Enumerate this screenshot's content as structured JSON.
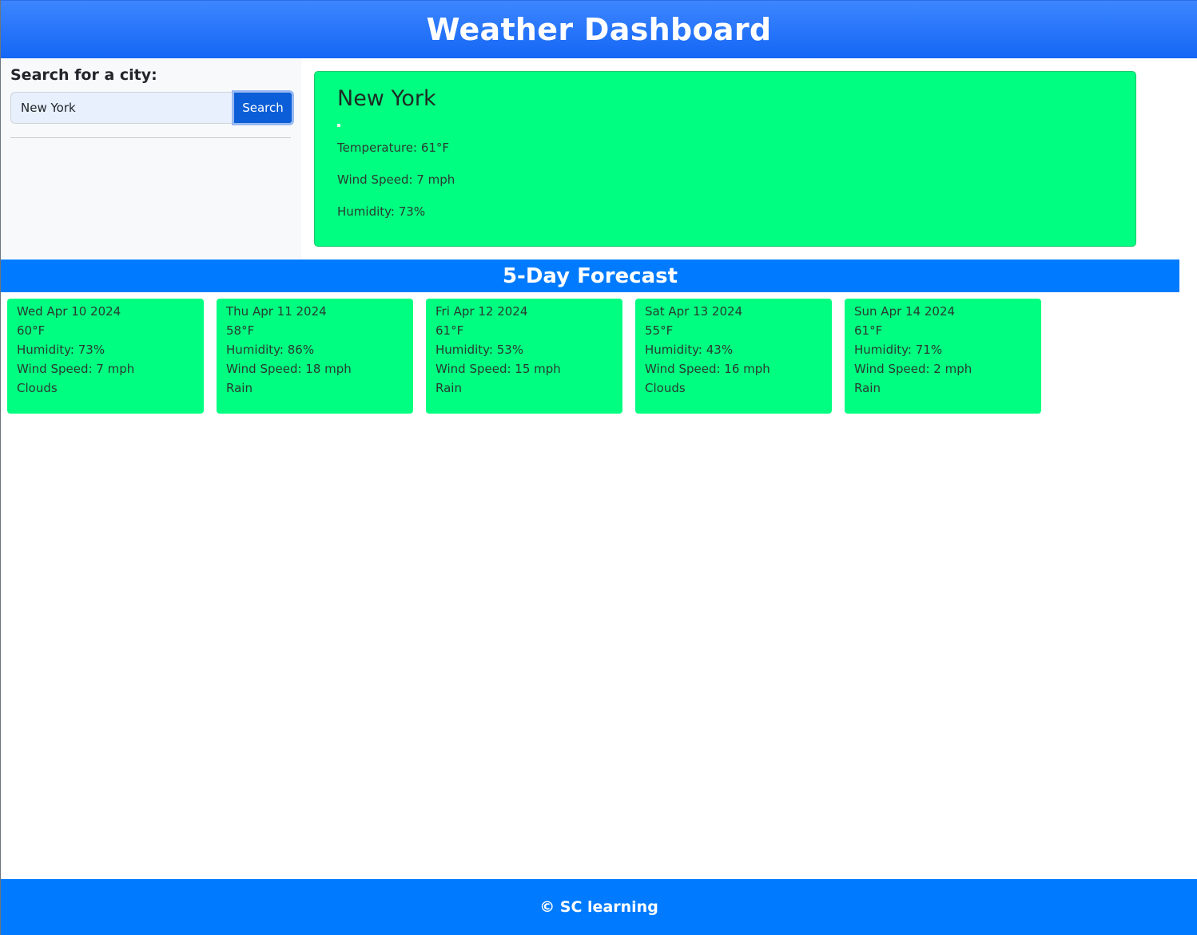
{
  "header": {
    "title": "Weather Dashboard"
  },
  "sidebar": {
    "heading": "Search for a city:",
    "search_value": "New York",
    "search_placeholder": "",
    "search_label": "Search"
  },
  "current": {
    "city": "New York",
    "temperature": "Temperature: 61°F",
    "wind": "Wind Speed: 7 mph",
    "humidity": "Humidity: 73%"
  },
  "forecast": {
    "heading": "5-Day Forecast",
    "days": [
      {
        "date": "Wed Apr 10 2024",
        "temp": "60°F",
        "humidity": "Humidity: 73%",
        "wind": "Wind Speed: 7 mph",
        "condition": "Clouds"
      },
      {
        "date": "Thu Apr 11 2024",
        "temp": "58°F",
        "humidity": "Humidity: 86%",
        "wind": "Wind Speed: 18 mph",
        "condition": "Rain"
      },
      {
        "date": "Fri Apr 12 2024",
        "temp": "61°F",
        "humidity": "Humidity: 53%",
        "wind": "Wind Speed: 15 mph",
        "condition": "Rain"
      },
      {
        "date": "Sat Apr 13 2024",
        "temp": "55°F",
        "humidity": "Humidity: 43%",
        "wind": "Wind Speed: 16 mph",
        "condition": "Clouds"
      },
      {
        "date": "Sun Apr 14 2024",
        "temp": "61°F",
        "humidity": "Humidity: 71%",
        "wind": "Wind Speed: 2 mph",
        "condition": "Rain"
      }
    ]
  },
  "footer": {
    "text": "© SC learning"
  },
  "colors": {
    "primary": "#007bff",
    "card": "#00ff80",
    "button": "#0b5ed7"
  }
}
